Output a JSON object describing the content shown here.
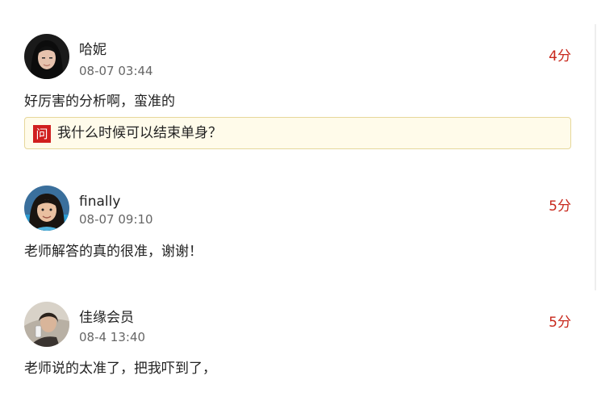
{
  "reviews": [
    {
      "user": "哈妮",
      "time": "08-07 03:44",
      "score": "4分",
      "comment": "好厉害的分析啊，蛮准的",
      "question": {
        "badge": "问",
        "text": "我什么时候可以结束单身？"
      }
    },
    {
      "user": "finally",
      "time": "08-07 09:10",
      "score": "5分",
      "comment": "老师解答的真的很准，谢谢！"
    },
    {
      "user": "佳缘会员",
      "time": "08-4 13:40",
      "score": "5分",
      "comment": "老师说的太准了，把我吓到了，"
    }
  ],
  "colors": {
    "score": "#c8281c",
    "question_border": "#e6d79a",
    "question_bg": "#fffbea",
    "badge_bg": "#d01f1f"
  }
}
